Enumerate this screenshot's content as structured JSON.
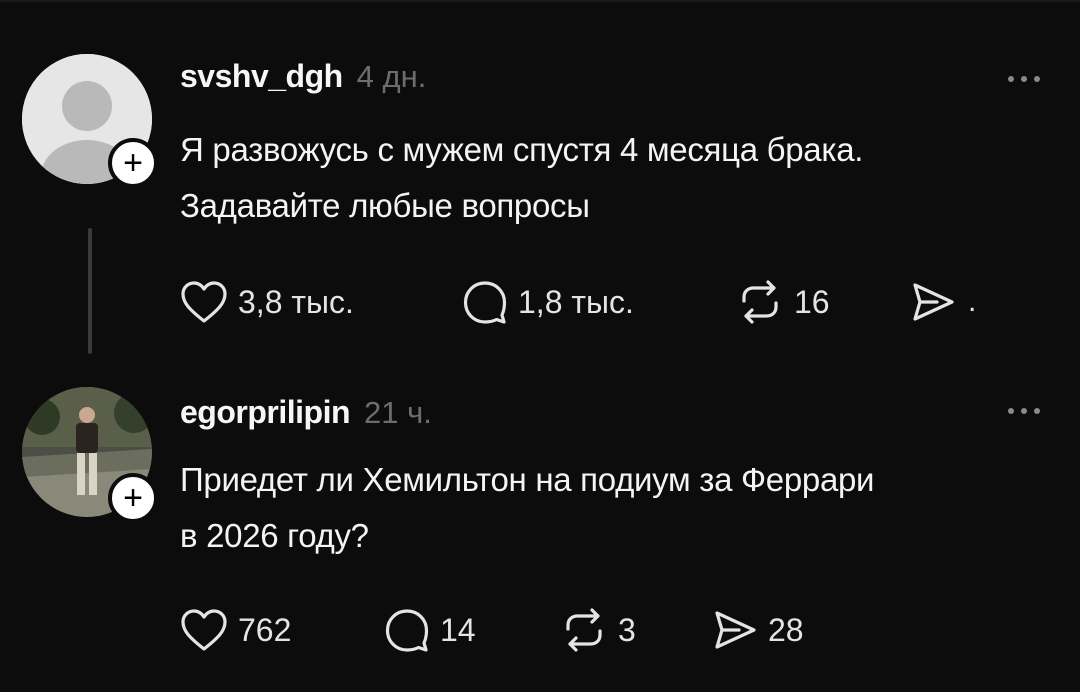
{
  "posts": [
    {
      "username": "svshv_dgh",
      "timestamp": "4 дн.",
      "text_line1": "Я развожусь с мужем спустя 4 месяца брака.",
      "text_line2": "Задавайте любые вопросы",
      "likes": "3,8 тыс.",
      "comments": "1,8 тыс.",
      "reposts": "16",
      "shares": ".",
      "avatar": "default-avatar-icon",
      "follow_symbol": "+"
    },
    {
      "username": "egorprilipin",
      "timestamp": "21 ч.",
      "text_line1": "Приедет ли Хемильтон на подиум за Феррари",
      "text_line2": "в 2026 году?",
      "likes": "762",
      "comments": "14",
      "reposts": "3",
      "shares": "28",
      "avatar": "user-photo",
      "follow_symbol": "+"
    }
  ],
  "icons": {
    "like": "heart-icon",
    "comment": "comment-bubble-icon",
    "repost": "repost-icon",
    "share": "send-icon",
    "more": "more-dots-icon"
  },
  "colors": {
    "background": "#0c0c0c",
    "text": "#f4f4f4",
    "muted": "#6d6d6d"
  }
}
